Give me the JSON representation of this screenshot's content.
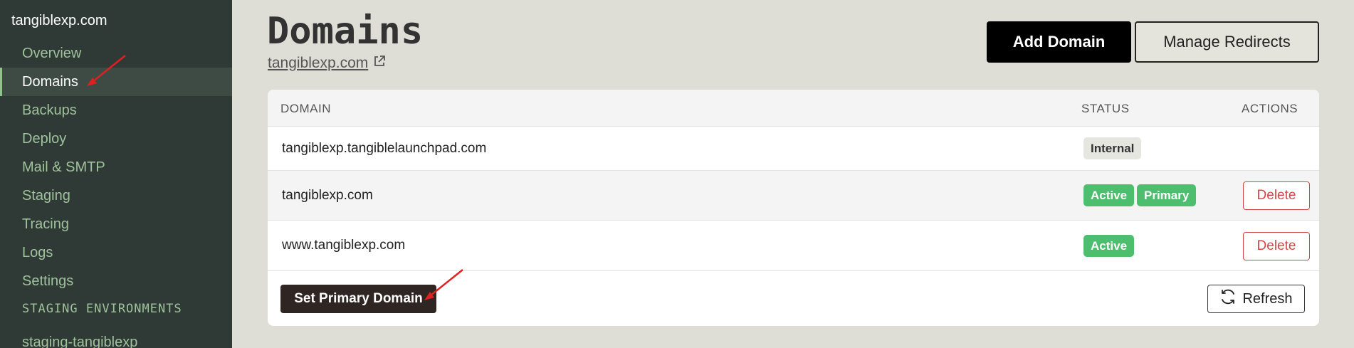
{
  "sidebar": {
    "site_name": "tangiblexp.com",
    "items": [
      {
        "label": "Overview"
      },
      {
        "label": "Domains",
        "active": true
      },
      {
        "label": "Backups"
      },
      {
        "label": "Deploy"
      },
      {
        "label": "Mail & SMTP"
      },
      {
        "label": "Staging"
      },
      {
        "label": "Tracing"
      },
      {
        "label": "Logs"
      },
      {
        "label": "Settings"
      }
    ],
    "section_title": "STAGING ENVIRONMENTS",
    "sub_item": "staging-tangiblexp"
  },
  "header": {
    "title": "Domains",
    "site_link": "tangiblexp.com",
    "add_domain_label": "Add Domain",
    "manage_redirects_label": "Manage Redirects"
  },
  "table": {
    "columns": [
      "DOMAIN",
      "STATUS",
      "ACTIONS"
    ],
    "rows": [
      {
        "domain": "tangiblexp.tangiblelaunchpad.com",
        "badges": [
          "Internal"
        ],
        "action": ""
      },
      {
        "domain": "tangiblexp.com",
        "badges": [
          "Active",
          "Primary"
        ],
        "action": "Delete"
      },
      {
        "domain": "www.tangiblexp.com",
        "badges": [
          "Active"
        ],
        "action": "Delete"
      }
    ]
  },
  "footer": {
    "set_primary_label": "Set Primary Domain",
    "refresh_label": "Refresh"
  },
  "colors": {
    "sidebar_bg": "#2f3a36",
    "badge_green": "#4dbe6e",
    "delete_red": "#d64545",
    "annotation_arrow": "#e02020"
  }
}
